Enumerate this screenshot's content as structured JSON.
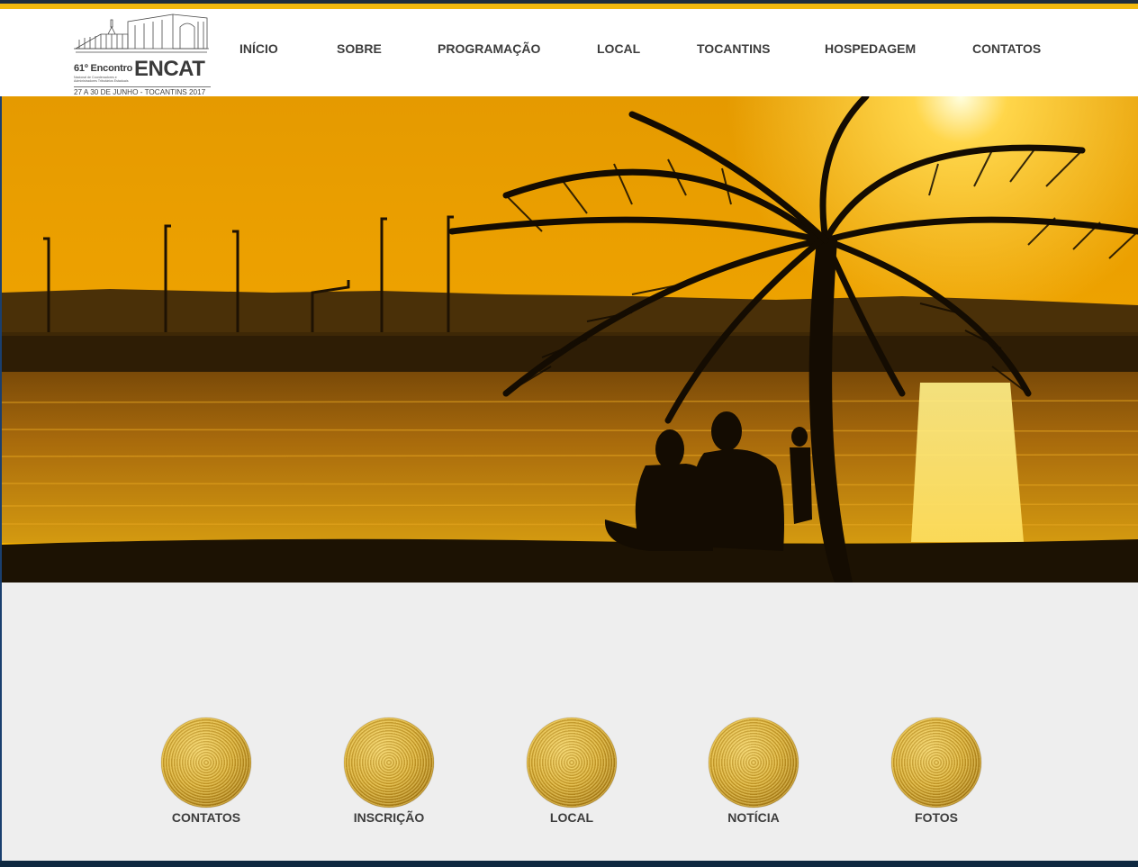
{
  "header": {
    "logo": {
      "edition": "61º Encontro",
      "subtitle": "Nacional de Coordenadores e Administradores Tributários Estaduais",
      "brand": "ENCAT",
      "date": "27 A 30 DE JUNHO - TOCANTINS 2017"
    },
    "nav": [
      {
        "label": "INÍCIO"
      },
      {
        "label": "SOBRE"
      },
      {
        "label": "PROGRAMAÇÃO"
      },
      {
        "label": "LOCAL"
      },
      {
        "label": "TOCANTINS"
      },
      {
        "label": "HOSPEDAGEM"
      },
      {
        "label": "CONTATOS"
      }
    ]
  },
  "tiles": [
    {
      "label": "CONTATOS"
    },
    {
      "label": "INSCRIÇÃO"
    },
    {
      "label": "LOCAL"
    },
    {
      "label": "NOTÍCIA"
    },
    {
      "label": "FOTOS"
    }
  ],
  "colors": {
    "accent_gold": "#f2b90f",
    "top_dark": "#1f2d3d",
    "text": "#3d3d3d",
    "lower_bg": "#eeeeee"
  }
}
